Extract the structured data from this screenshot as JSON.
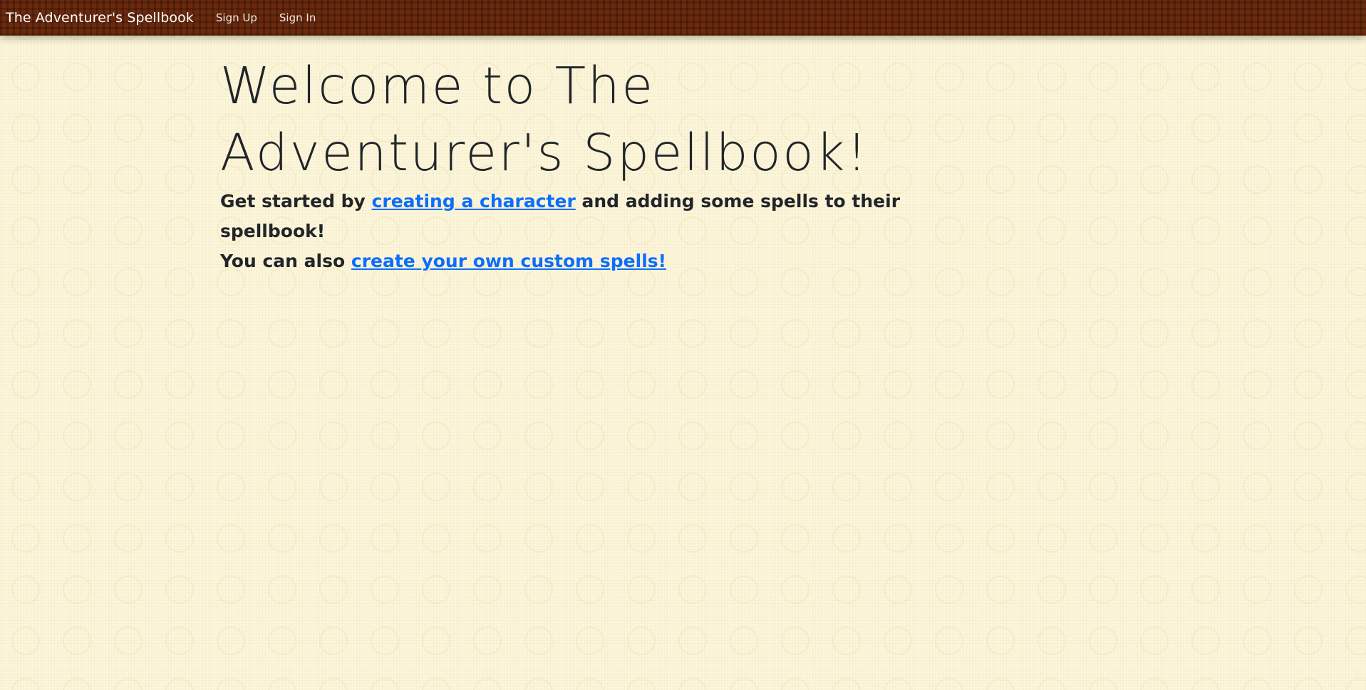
{
  "navbar": {
    "brand": "The Adventurer's Spellbook",
    "links": [
      {
        "label": "Sign Up"
      },
      {
        "label": "Sign In"
      }
    ]
  },
  "main": {
    "title": "Welcome to The Adventurer's Spellbook!",
    "line1": {
      "prefix": "Get started by ",
      "link_text": "creating a character",
      "suffix": " and adding some spells to their spellbook!"
    },
    "line2": {
      "prefix": "You can also ",
      "link_text": "create your own custom spells!"
    }
  },
  "colors": {
    "navbar_bg": "#6b2a0d",
    "page_bg": "#fcf6dc",
    "link": "#0d6efd",
    "text": "#212529"
  }
}
